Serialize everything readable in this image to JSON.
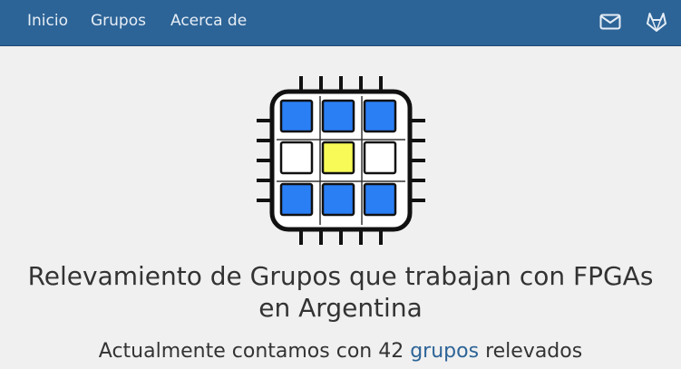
{
  "nav": {
    "items": [
      {
        "label": "Inicio"
      },
      {
        "label": "Grupos"
      },
      {
        "label": "Acerca de"
      }
    ],
    "icons": [
      "mail-icon",
      "gitlab-icon"
    ]
  },
  "logo": {
    "cell_colors": [
      [
        "#2a7ff5",
        "#2a7ff5",
        "#2a7ff5"
      ],
      [
        "#ffffff",
        "#f8fb57",
        "#ffffff"
      ],
      [
        "#2a7ff5",
        "#2a7ff5",
        "#2a7ff5"
      ]
    ]
  },
  "hero": {
    "title_line1": "Relevamiento de Grupos que trabajan con FPGAs",
    "title_line2": "en Argentina",
    "subtitle_prefix": "Actualmente contamos con 42",
    "subtitle_link": "grupos",
    "subtitle_suffix": "relevados"
  },
  "colors": {
    "navbar": "#2d6497",
    "link": "#2d6497",
    "background": "#f0f0f0"
  }
}
